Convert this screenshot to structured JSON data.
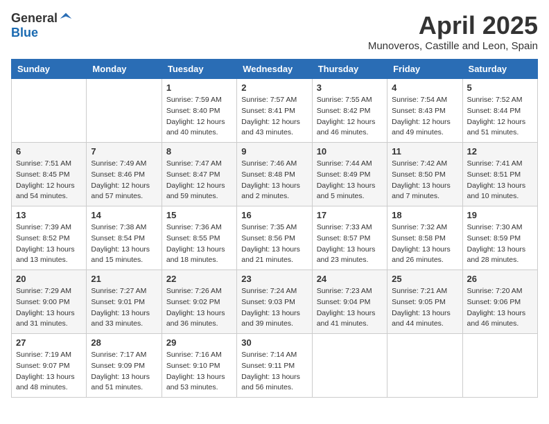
{
  "logo": {
    "general": "General",
    "blue": "Blue"
  },
  "title": "April 2025",
  "location": "Munoveros, Castille and Leon, Spain",
  "weekdays": [
    "Sunday",
    "Monday",
    "Tuesday",
    "Wednesday",
    "Thursday",
    "Friday",
    "Saturday"
  ],
  "weeks": [
    [
      {
        "day": "",
        "info": ""
      },
      {
        "day": "",
        "info": ""
      },
      {
        "day": "1",
        "info": "Sunrise: 7:59 AM\nSunset: 8:40 PM\nDaylight: 12 hours and 40 minutes."
      },
      {
        "day": "2",
        "info": "Sunrise: 7:57 AM\nSunset: 8:41 PM\nDaylight: 12 hours and 43 minutes."
      },
      {
        "day": "3",
        "info": "Sunrise: 7:55 AM\nSunset: 8:42 PM\nDaylight: 12 hours and 46 minutes."
      },
      {
        "day": "4",
        "info": "Sunrise: 7:54 AM\nSunset: 8:43 PM\nDaylight: 12 hours and 49 minutes."
      },
      {
        "day": "5",
        "info": "Sunrise: 7:52 AM\nSunset: 8:44 PM\nDaylight: 12 hours and 51 minutes."
      }
    ],
    [
      {
        "day": "6",
        "info": "Sunrise: 7:51 AM\nSunset: 8:45 PM\nDaylight: 12 hours and 54 minutes."
      },
      {
        "day": "7",
        "info": "Sunrise: 7:49 AM\nSunset: 8:46 PM\nDaylight: 12 hours and 57 minutes."
      },
      {
        "day": "8",
        "info": "Sunrise: 7:47 AM\nSunset: 8:47 PM\nDaylight: 12 hours and 59 minutes."
      },
      {
        "day": "9",
        "info": "Sunrise: 7:46 AM\nSunset: 8:48 PM\nDaylight: 13 hours and 2 minutes."
      },
      {
        "day": "10",
        "info": "Sunrise: 7:44 AM\nSunset: 8:49 PM\nDaylight: 13 hours and 5 minutes."
      },
      {
        "day": "11",
        "info": "Sunrise: 7:42 AM\nSunset: 8:50 PM\nDaylight: 13 hours and 7 minutes."
      },
      {
        "day": "12",
        "info": "Sunrise: 7:41 AM\nSunset: 8:51 PM\nDaylight: 13 hours and 10 minutes."
      }
    ],
    [
      {
        "day": "13",
        "info": "Sunrise: 7:39 AM\nSunset: 8:52 PM\nDaylight: 13 hours and 13 minutes."
      },
      {
        "day": "14",
        "info": "Sunrise: 7:38 AM\nSunset: 8:54 PM\nDaylight: 13 hours and 15 minutes."
      },
      {
        "day": "15",
        "info": "Sunrise: 7:36 AM\nSunset: 8:55 PM\nDaylight: 13 hours and 18 minutes."
      },
      {
        "day": "16",
        "info": "Sunrise: 7:35 AM\nSunset: 8:56 PM\nDaylight: 13 hours and 21 minutes."
      },
      {
        "day": "17",
        "info": "Sunrise: 7:33 AM\nSunset: 8:57 PM\nDaylight: 13 hours and 23 minutes."
      },
      {
        "day": "18",
        "info": "Sunrise: 7:32 AM\nSunset: 8:58 PM\nDaylight: 13 hours and 26 minutes."
      },
      {
        "day": "19",
        "info": "Sunrise: 7:30 AM\nSunset: 8:59 PM\nDaylight: 13 hours and 28 minutes."
      }
    ],
    [
      {
        "day": "20",
        "info": "Sunrise: 7:29 AM\nSunset: 9:00 PM\nDaylight: 13 hours and 31 minutes."
      },
      {
        "day": "21",
        "info": "Sunrise: 7:27 AM\nSunset: 9:01 PM\nDaylight: 13 hours and 33 minutes."
      },
      {
        "day": "22",
        "info": "Sunrise: 7:26 AM\nSunset: 9:02 PM\nDaylight: 13 hours and 36 minutes."
      },
      {
        "day": "23",
        "info": "Sunrise: 7:24 AM\nSunset: 9:03 PM\nDaylight: 13 hours and 39 minutes."
      },
      {
        "day": "24",
        "info": "Sunrise: 7:23 AM\nSunset: 9:04 PM\nDaylight: 13 hours and 41 minutes."
      },
      {
        "day": "25",
        "info": "Sunrise: 7:21 AM\nSunset: 9:05 PM\nDaylight: 13 hours and 44 minutes."
      },
      {
        "day": "26",
        "info": "Sunrise: 7:20 AM\nSunset: 9:06 PM\nDaylight: 13 hours and 46 minutes."
      }
    ],
    [
      {
        "day": "27",
        "info": "Sunrise: 7:19 AM\nSunset: 9:07 PM\nDaylight: 13 hours and 48 minutes."
      },
      {
        "day": "28",
        "info": "Sunrise: 7:17 AM\nSunset: 9:09 PM\nDaylight: 13 hours and 51 minutes."
      },
      {
        "day": "29",
        "info": "Sunrise: 7:16 AM\nSunset: 9:10 PM\nDaylight: 13 hours and 53 minutes."
      },
      {
        "day": "30",
        "info": "Sunrise: 7:14 AM\nSunset: 9:11 PM\nDaylight: 13 hours and 56 minutes."
      },
      {
        "day": "",
        "info": ""
      },
      {
        "day": "",
        "info": ""
      },
      {
        "day": "",
        "info": ""
      }
    ]
  ]
}
